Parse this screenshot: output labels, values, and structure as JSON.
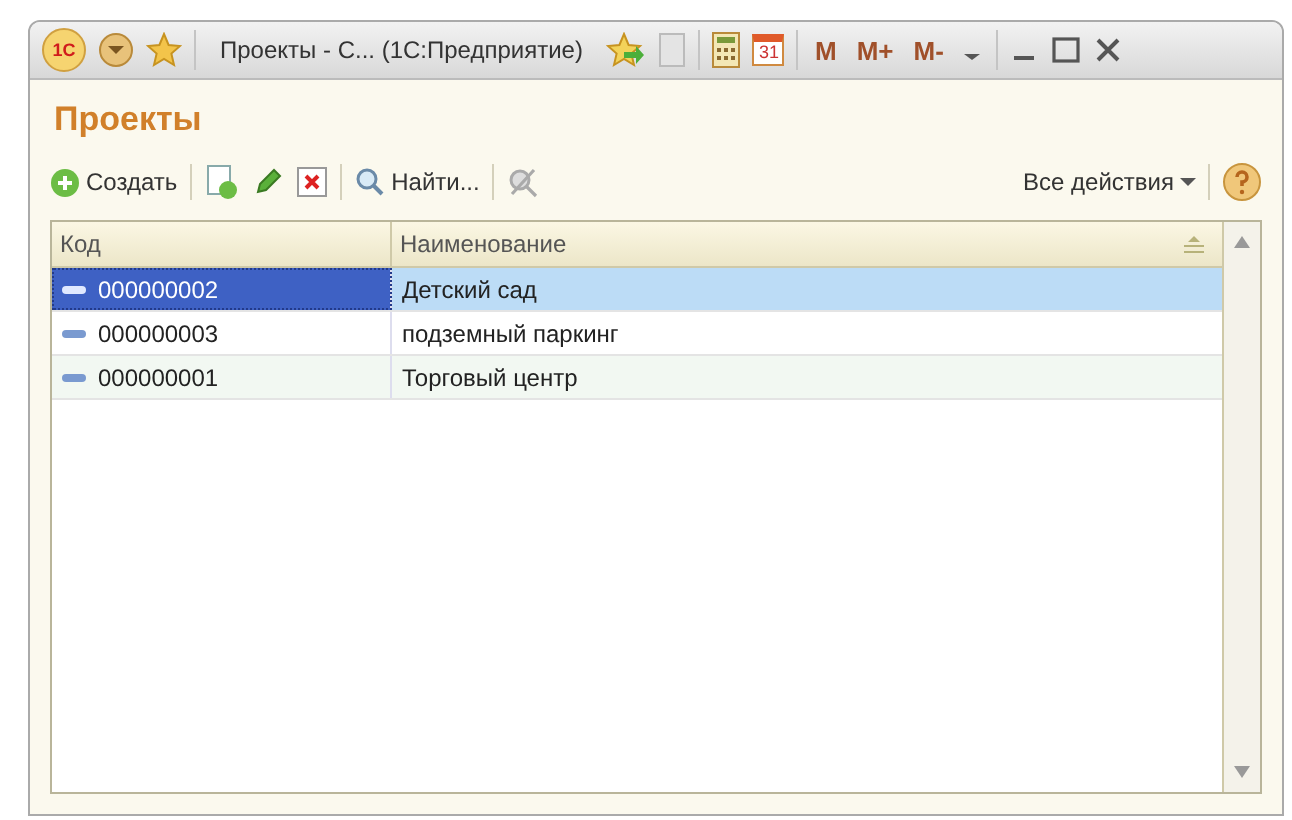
{
  "window": {
    "logo": "1С",
    "title": "Проекты - С... (1С:Предприятие)",
    "calendar_day": "31",
    "memory_buttons": [
      "M",
      "M+",
      "M-"
    ]
  },
  "form": {
    "title": "Проекты"
  },
  "toolbar": {
    "create": "Создать",
    "find": "Найти...",
    "all_actions": "Все действия"
  },
  "table": {
    "columns": [
      "Код",
      "Наименование"
    ],
    "rows": [
      {
        "code": "000000002",
        "name": "Детский сад",
        "selected": true
      },
      {
        "code": "000000003",
        "name": "подземный паркинг",
        "selected": false
      },
      {
        "code": "000000001",
        "name": "Торговый центр",
        "selected": false
      }
    ]
  }
}
